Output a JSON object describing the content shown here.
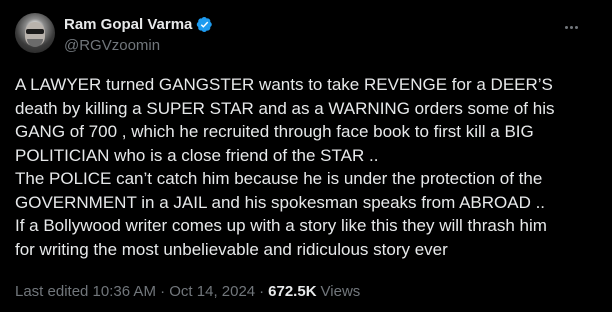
{
  "author": {
    "display_name": "Ram Gopal Varma",
    "handle": "@RGVzoomin",
    "verified_color": "#1d9bf0"
  },
  "icons": {
    "verified": "verified-badge-icon",
    "more": "more-options-icon"
  },
  "tweet": {
    "lines": [
      "A LAWYER turned GANGSTER wants to take REVENGE for a DEER’S",
      "death by killing a SUPER STAR and as a WARNING orders some of his",
      "GANG of 700 , which he recruited through face book to first kill a BIG",
      "POLITICIAN who is a close friend of the STAR ..",
      "The POLICE can’t catch him because he is under the protection of the",
      "GOVERNMENT in a JAIL and his spokesman speaks from ABROAD ..",
      "If a Bollywood writer comes up with a story like this they will thrash him",
      "for writing the most unbelievable and ridiculous story ever"
    ]
  },
  "meta": {
    "edited_label": "Last edited 10:36 AM · Oct 14, 2024",
    "separator": "·",
    "views_count": "672.5K",
    "views_label": "Views"
  }
}
